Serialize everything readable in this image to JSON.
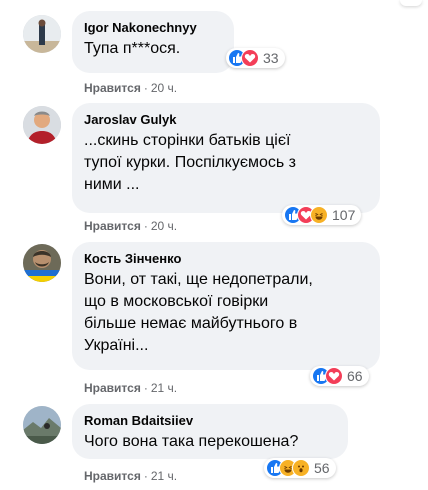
{
  "comments": [
    {
      "author": "Igor Nakonechnyy",
      "lines": [
        "Тупа п***ося."
      ],
      "like_label": "Нравится",
      "separator": "·",
      "time": "20 ч.",
      "reaction_count": "33",
      "reactions": [
        "like-icon",
        "love-icon"
      ]
    },
    {
      "author": "Jaroslav Gulyk",
      "lines": [
        "...скинь сторінки батьків цієї",
        "тупої курки. Поспілкуємось з",
        "ними ..."
      ],
      "like_label": "Нравится",
      "separator": "·",
      "time": "20 ч.",
      "reaction_count": "107",
      "reactions": [
        "like-icon",
        "love-icon",
        "haha-icon"
      ]
    },
    {
      "author": "Кость Зінченко",
      "lines": [
        "Вони, от такі, ще недопетрали,",
        "що в московської говірки",
        "більше немає майбутнього в",
        "Україні..."
      ],
      "like_label": "Нравится",
      "separator": "·",
      "time": "21 ч.",
      "reaction_count": "66",
      "reactions": [
        "like-icon",
        "love-icon"
      ]
    },
    {
      "author": "Roman Bdaitsiiev",
      "lines": [
        "Чого вона така перекошена?"
      ],
      "like_label": "Нравится",
      "separator": "·",
      "time": "21 ч.",
      "reaction_count": "56",
      "reactions": [
        "like-icon",
        "haha-icon",
        "wow-icon"
      ]
    }
  ],
  "colors": {
    "bubble": "#f0f2f5",
    "meta": "#65676b",
    "like": "#1877f2",
    "love": "#f33e58",
    "haha": "#f7b125"
  }
}
